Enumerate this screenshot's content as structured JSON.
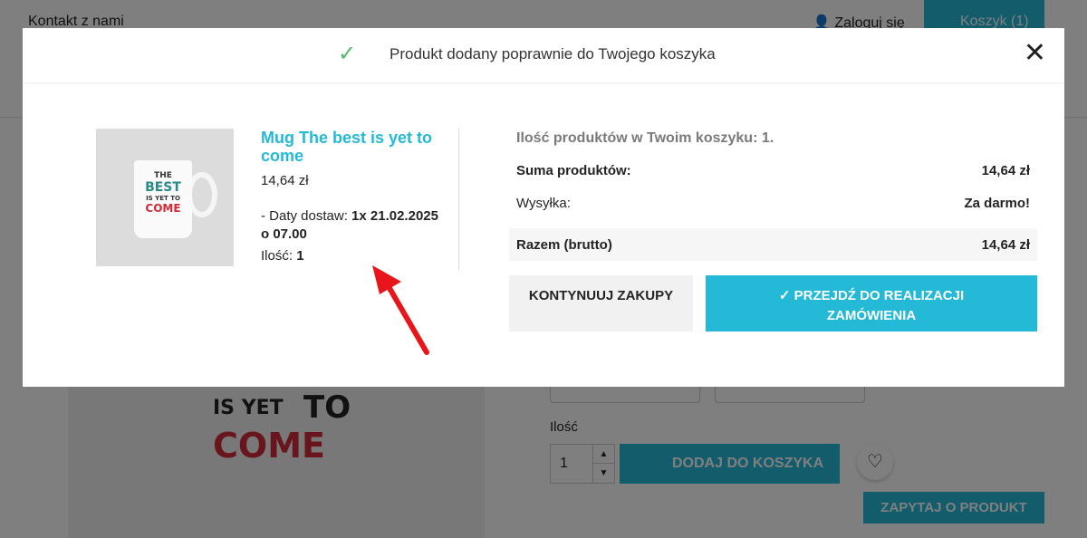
{
  "header": {
    "contact": "Kontakt z nami",
    "login": "Zaloguj się",
    "cart": "Koszyk (1)"
  },
  "background_page": {
    "big_mug_text": [
      "IS YET",
      "TO",
      "COME"
    ],
    "quantity_label": "Ilość",
    "quantity_value": "1",
    "add_to_cart": "DODAJ DO KOSZYKA",
    "ask_product": "ZAPYTAJ O PRODUKT"
  },
  "modal": {
    "title": "Produkt dodany poprawnie do Twojego koszyka",
    "product": {
      "name": "Mug The best is yet to come",
      "price": "14,64 zł",
      "dates_label": "- Daty dostaw:",
      "dates_value": "1x 21.02.2025 o 07.00",
      "qty_label": "Ilość:",
      "qty_value": "1",
      "image_text": [
        "THE",
        "BEST",
        "IS YET TO",
        "COME"
      ]
    },
    "cart": {
      "count_text": "Ilość produktów w Twoim koszyku: 1.",
      "subtotal_label": "Suma produktów:",
      "subtotal_value": "14,64 zł",
      "shipping_label": "Wysyłka:",
      "shipping_value": "Za darmo!",
      "total_label": "Razem (brutto)",
      "total_value": "14,64 zł"
    },
    "continue_button": "KONTYNUUJ ZAKUPY",
    "checkout_button": "PRZEJDŹ DO REALIZACJI ZAMÓWIENIA"
  },
  "colors": {
    "accent": "#24b9d7",
    "success": "#4cbb6c",
    "arrow": "#e8161b"
  }
}
